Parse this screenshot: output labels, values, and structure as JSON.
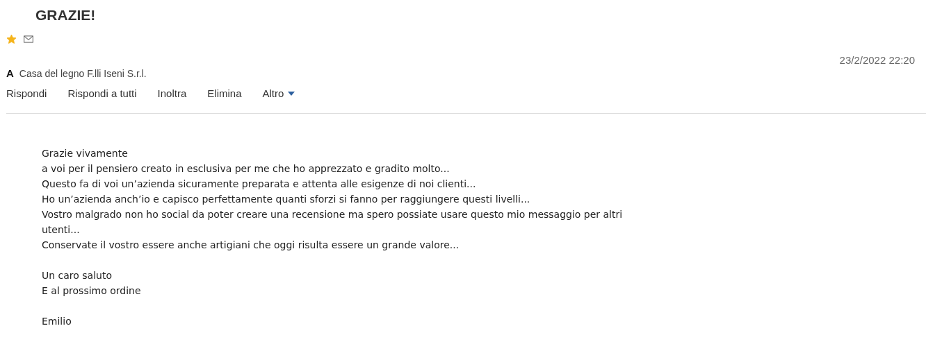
{
  "subject": "GRAZIE!",
  "starred": true,
  "date": "23/2/2022 22:20",
  "to": {
    "label": "A",
    "name": "Casa del legno F.lli Iseni S.r.l."
  },
  "actions": [
    {
      "label": "Rispondi",
      "kind": "plain"
    },
    {
      "label": "Rispondi a tutti",
      "kind": "plain"
    },
    {
      "label": "Inoltra",
      "kind": "plain"
    },
    {
      "label": "Elimina",
      "kind": "plain"
    },
    {
      "label": "Altro",
      "kind": "dropdown"
    }
  ],
  "body": [
    {
      "lines": [
        "Grazie vivamente",
        "a voi per il pensiero creato in esclusiva per me che ho apprezzato e gradito molto...",
        "Questo fa di voi un’azienda sicuramente preparata e attenta alle esigenze di noi clienti...",
        "Ho un’azienda anch’io e capisco perfettamente quanti sforzi si fanno per raggiungere questi livelli...",
        "Vostro malgrado non ho social da poter creare una recensione ma spero possiate usare questo mio messaggio per altri utenti...",
        "Conservate il vostro essere anche artigiani che oggi risulta essere un grande valore..."
      ]
    },
    {
      "lines": [
        "Un caro saluto",
        "E al prossimo ordine"
      ]
    },
    {
      "lines": [
        "Emilio"
      ]
    }
  ]
}
